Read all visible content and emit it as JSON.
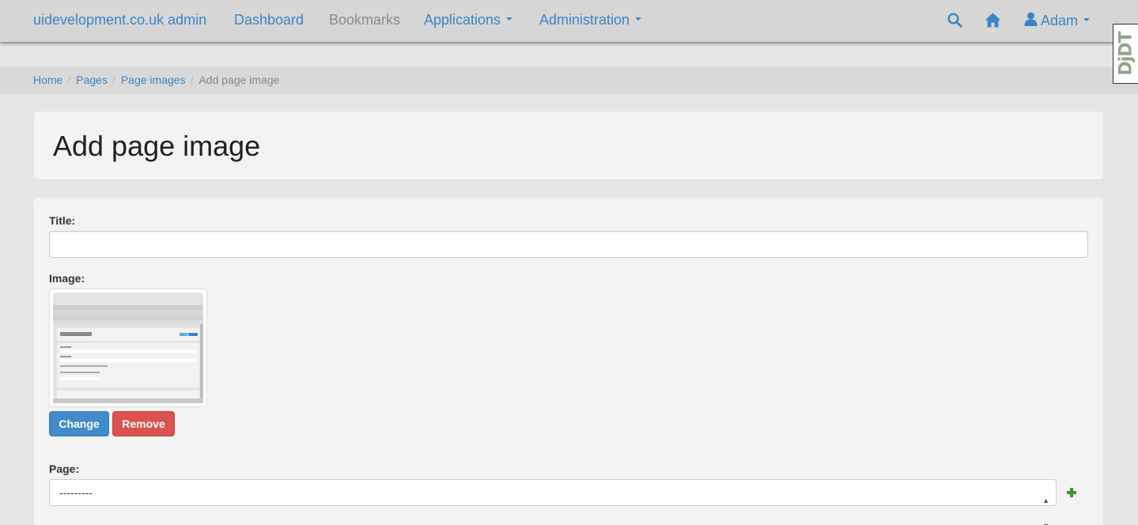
{
  "navbar": {
    "brand": "uidevelopment.co.uk admin",
    "items": [
      {
        "label": "Dashboard"
      },
      {
        "label": "Bookmarks"
      },
      {
        "label": "Applications"
      },
      {
        "label": "Administration"
      }
    ],
    "user": "Adam",
    "icons": [
      "search-icon",
      "home-icon",
      "user-icon"
    ]
  },
  "debug_toolbar": {
    "label": "DjDT"
  },
  "breadcrumb": {
    "items": [
      "Home",
      "Pages",
      "Page images"
    ],
    "active": "Add page image"
  },
  "page": {
    "title": "Add page image"
  },
  "form": {
    "title_label": "Title:",
    "title_value": "",
    "image_label": "Image:",
    "change_button": "Change",
    "remove_button": "Remove",
    "page_label": "Page:",
    "page_selected": "---------"
  },
  "colors": {
    "link": "#3a85c9",
    "primary": "#428bca",
    "danger": "#d9534f",
    "add": "#3d9a2f"
  }
}
